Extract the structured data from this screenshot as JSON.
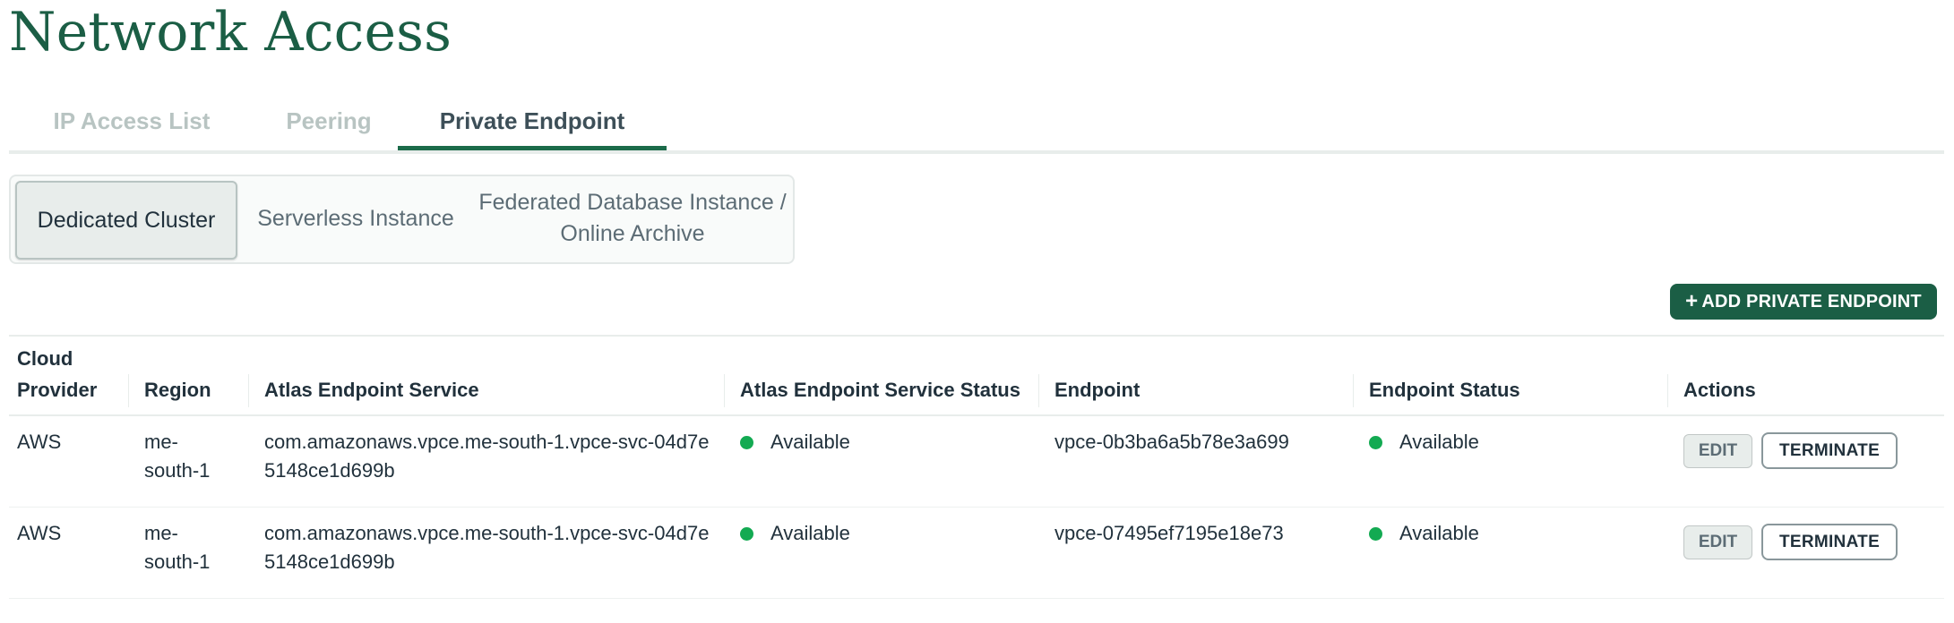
{
  "page": {
    "title": "Network Access"
  },
  "tabs": [
    {
      "label": "IP Access List"
    },
    {
      "label": "Peering"
    },
    {
      "label": "Private Endpoint"
    }
  ],
  "segments": [
    {
      "label": "Dedicated Cluster"
    },
    {
      "label": "Serverless Instance"
    },
    {
      "label": "Federated Database Instance / Online Archive"
    }
  ],
  "toolbar": {
    "add_icon": "+",
    "add_label": "ADD PRIVATE ENDPOINT"
  },
  "table": {
    "columns": [
      "Cloud Provider",
      "Region",
      "Atlas Endpoint Service",
      "Atlas Endpoint Service Status",
      "Endpoint",
      "Endpoint Status",
      "Actions"
    ],
    "rows": [
      {
        "provider": "AWS",
        "region": "me-south-1",
        "service": "com.amazonaws.vpce.me-south-1.vpce-svc-04d7e5148ce1d699b",
        "service_status": "Available",
        "endpoint": "vpce-0b3ba6a5b78e3a699",
        "endpoint_status": "Available",
        "edit_label": "EDIT",
        "terminate_label": "TERMINATE"
      },
      {
        "provider": "AWS",
        "region": "me-south-1",
        "service": "com.amazonaws.vpce.me-south-1.vpce-svc-04d7e5148ce1d699b",
        "service_status": "Available",
        "endpoint": "vpce-07495ef7195e18e73",
        "endpoint_status": "Available",
        "edit_label": "EDIT",
        "terminate_label": "TERMINATE"
      }
    ]
  },
  "colors": {
    "brand": "#1b5e45",
    "accent": "#1b6b4a",
    "status_ok": "#13aa52"
  }
}
